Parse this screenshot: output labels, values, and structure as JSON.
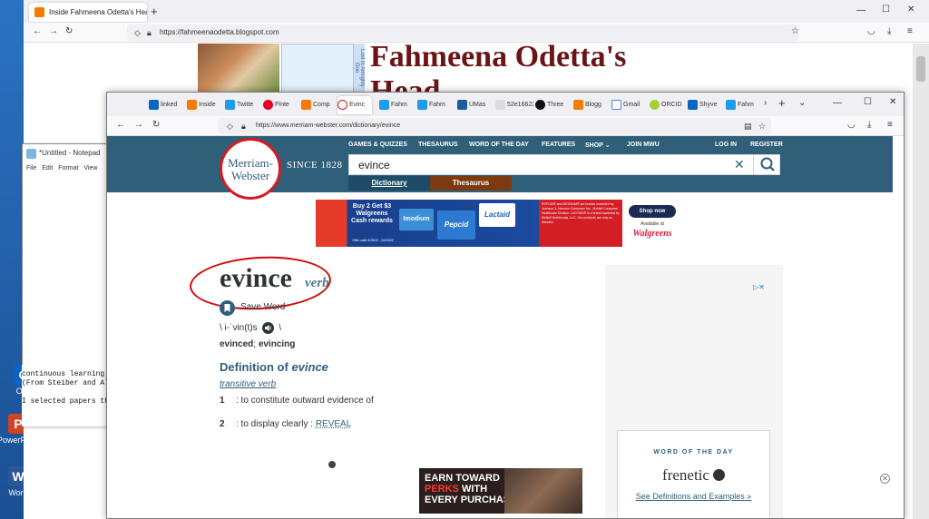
{
  "desktop": {
    "icons": [
      {
        "label": "Outl",
        "color": "#0a64c8",
        "glyph": "O"
      },
      {
        "label": "PowerPoint",
        "color": "#d04423",
        "glyph": "P"
      },
      {
        "label": "Word",
        "color": "#2b5797",
        "glyph": "W"
      }
    ]
  },
  "bg_browser": {
    "tab_title": "Inside Fahmeena Odetta's Head",
    "url": "https://fahmeenaodetta.blogspot.com",
    "blog_title": "Fahmeena Odetta's",
    "blog_title_cut": "Head",
    "sidebar_vertical": "Lost in Almighty Goo"
  },
  "notepad": {
    "title": "*Untitled - Notepad",
    "menu": [
      "File",
      "Edit",
      "Format",
      "View"
    ],
    "left_chars": [
      "O",
      "m",
      "I",
      "P",
      "O",
      "v",
      "C",
      "i",
      "i",
      "f",
      "i",
      "i"
    ],
    "bottom_lines": [
      "continuous learning;",
      "(From Steiber and Al",
      "",
      "I selected papers th"
    ]
  },
  "fg_browser": {
    "tabs": [
      {
        "label": "linked",
        "color": "#0a66c2"
      },
      {
        "label": "Inside",
        "color": "#f57c00"
      },
      {
        "label": "Twitte",
        "color": "#1d9bf0"
      },
      {
        "label": "Pinte",
        "color": "#e60023"
      },
      {
        "label": "Comp",
        "color": "#f57c00"
      },
      {
        "label": "Evinc",
        "color": "#d71920"
      },
      {
        "label": "Fahm",
        "color": "#1d9bf0"
      },
      {
        "label": "Fahm",
        "color": "#1d9bf0"
      },
      {
        "label": "UMas",
        "color": "#1a5d9c"
      },
      {
        "label": "52e16622",
        "color": "#666666"
      },
      {
        "label": "Three",
        "color": "#111111"
      },
      {
        "label": "Blogg",
        "color": "#f57c00"
      },
      {
        "label": "Gmail",
        "color": "#4285f4"
      },
      {
        "label": "ORCID",
        "color": "#a6ce39"
      },
      {
        "label": "Shyve",
        "color": "#0a66c2"
      },
      {
        "label": "Fahm",
        "color": "#1d9bf0"
      }
    ],
    "url": "https://www.merriam-webster.com/dictionary/evince"
  },
  "mw": {
    "logo_line1": "Merriam-",
    "logo_line2": "Webster",
    "since": "SINCE 1828",
    "nav": [
      "GAMES & QUIZZES",
      "THESAURUS",
      "WORD OF THE DAY",
      "FEATURES",
      "SHOP",
      "JOIN MWU"
    ],
    "login": "LOG IN",
    "register": "REGISTER",
    "search_value": "evince",
    "tab_dictionary": "Dictionary",
    "tab_thesaurus": "Thesaurus",
    "ad_top": {
      "headline": "Buy 2 Get $3 Walgreens Cash rewards",
      "offer": "Offer valid 9/25/22 - 10/29/22",
      "brands": [
        "Imodium",
        "Pepcid",
        "Lactaid"
      ],
      "fine_print": "PEPCID® and IMODIUM® are brands marketed by Johnson & Johnson Consumer Inc., McNeil Consumer Healthcare Division. LACTAID® is a brand marketed by McNeil Nutritionals, LLC. Our products are only as directed.",
      "cta": "Shop now",
      "available": "Available at",
      "store": "Walgreens"
    },
    "headword": "evince",
    "pos": "verb",
    "save_word": "Save Word",
    "pron_open": "\\ i-ˈvin(t)s",
    "pron_close": "\\",
    "infl_1": "evinced",
    "infl_sep": "; ",
    "infl_2": "evincing",
    "def_heading_prefix": "Definition of ",
    "def_heading_word": "evince",
    "transitive": "transitive verb",
    "senses": [
      {
        "num": "1",
        "text": ": to constitute outward evidence of",
        "link": ""
      },
      {
        "num": "2",
        "text": ": to display clearly : ",
        "link": "REVEAL"
      }
    ],
    "ad_bottom": {
      "line1": "EARN TOWARD",
      "line2_highlight": "PERKS",
      "line2_rest": " WITH",
      "line3": "EVERY PURCHASE"
    },
    "wotd_heading": "WORD OF THE DAY",
    "wotd_word": "frenetic",
    "wotd_link": "See Definitions and Examples",
    "wotd_arrow": "»"
  }
}
